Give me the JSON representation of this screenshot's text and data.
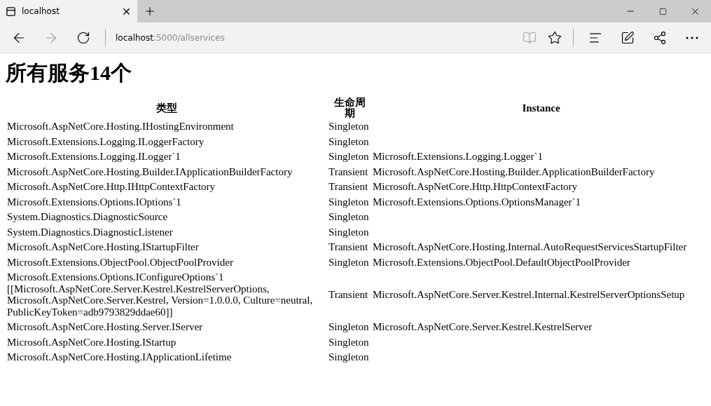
{
  "browser": {
    "tab_title": "localhost",
    "url_host": "localhost",
    "url_path": ":5000/allservices",
    "back_disabled": false,
    "forward_disabled": true,
    "reading_view_disabled": true
  },
  "heading": "所有服务14个",
  "columns": [
    "类型",
    "生命周期",
    "Instance"
  ],
  "rows": [
    {
      "type": "Microsoft.AspNetCore.Hosting.IHostingEnvironment",
      "lifetime": "Singleton"
    },
    {
      "type": "Microsoft.Extensions.Logging.ILoggerFactory",
      "lifetime": "Singleton"
    },
    {
      "type": "Microsoft.Extensions.Logging.ILogger`1",
      "lifetime": "Singleton",
      "instance": "Microsoft.Extensions.Logging.Logger`1"
    },
    {
      "type": "Microsoft.AspNetCore.Hosting.Builder.IApplicationBuilderFactory",
      "lifetime": "Transient",
      "instance": "Microsoft.AspNetCore.Hosting.Builder.ApplicationBuilderFactory"
    },
    {
      "type": "Microsoft.AspNetCore.Http.IHttpContextFactory",
      "lifetime": "Transient",
      "instance": "Microsoft.AspNetCore.Http.HttpContextFactory"
    },
    {
      "type": "Microsoft.Extensions.Options.IOptions`1",
      "lifetime": "Singleton",
      "instance": "Microsoft.Extensions.Options.OptionsManager`1"
    },
    {
      "type": "System.Diagnostics.DiagnosticSource",
      "lifetime": "Singleton"
    },
    {
      "type": "System.Diagnostics.DiagnosticListener",
      "lifetime": "Singleton"
    },
    {
      "type": "Microsoft.AspNetCore.Hosting.IStartupFilter",
      "lifetime": "Transient",
      "instance": "Microsoft.AspNetCore.Hosting.Internal.AutoRequestServicesStartupFilter"
    },
    {
      "type": "Microsoft.Extensions.ObjectPool.ObjectPoolProvider",
      "lifetime": "Singleton",
      "instance": "Microsoft.Extensions.ObjectPool.DefaultObjectPoolProvider"
    },
    {
      "type": "Microsoft.Extensions.Options.IConfigureOptions`1 [[Microsoft.AspNetCore.Server.Kestrel.KestrelServerOptions, Microsoft.AspNetCore.Server.Kestrel, Version=1.0.0.0, Culture=neutral, PublicKeyToken=adb9793829ddae60]]",
      "lifetime": "Transient",
      "instance": "Microsoft.AspNetCore.Server.Kestrel.Internal.KestrelServerOptionsSetup"
    },
    {
      "type": "Microsoft.AspNetCore.Hosting.Server.IServer",
      "lifetime": "Singleton",
      "instance": "Microsoft.AspNetCore.Server.Kestrel.KestrelServer"
    },
    {
      "type": "Microsoft.AspNetCore.Hosting.IStartup",
      "lifetime": "Singleton"
    },
    {
      "type": "Microsoft.AspNetCore.Hosting.IApplicationLifetime",
      "lifetime": "Singleton"
    }
  ]
}
